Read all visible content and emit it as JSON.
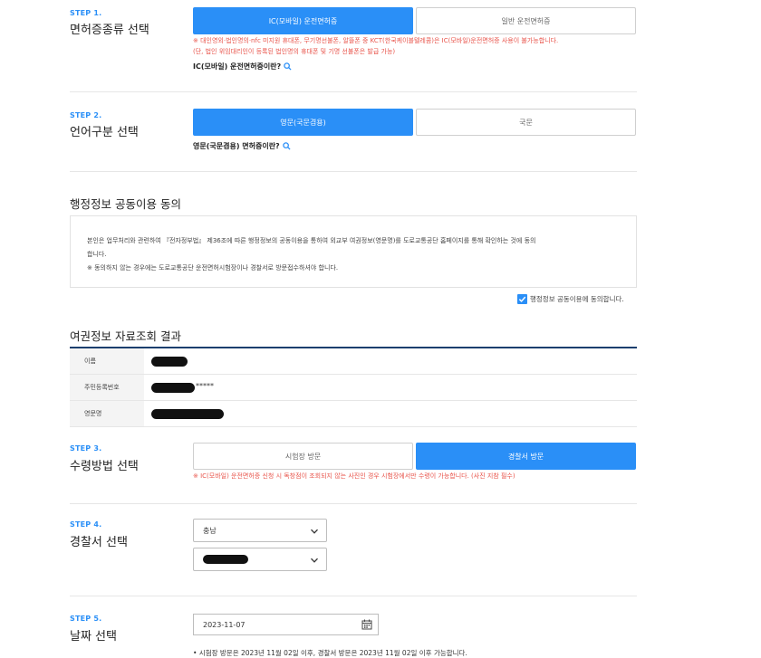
{
  "step1": {
    "label": "STEP 1.",
    "title": "면허증종류 선택",
    "option_ic": "IC(모바일) 운전면허증",
    "option_normal": "일반 운전면허증",
    "note_line1": "※ 대인영외·법인명의·nfc 미지원 휴대폰, 무기명선불폰, 알뜰폰 중 KCT(한국케이블텔레콤)은 IC(모바일)운전면허증 사용이 불가능합니다.",
    "note_line2": "(단, 법인 위임대리인이 등록된 법인명의 휴대폰 및 기명 선불폰은 발급 가능)",
    "info_link": "IC(모바일) 운전면허증이란?"
  },
  "step2": {
    "label": "STEP 2.",
    "title": "언어구분 선택",
    "option_english": "영문(국문겸용)",
    "option_korean": "국문",
    "info_link": "영문(국문겸용) 면허증이란?"
  },
  "consent": {
    "heading": "행정정보 공동이용 동의",
    "text_line1": "본인은 업무처리와 관련하여 『전자정부법』 제36조에 따른 행정정보의 공동이용을 통하여 외교부 여권정보(영문명)를 도로교통공단 홈페이지를 통해 확인하는 것에 동의",
    "text_line2": "합니다.",
    "text_line3": "※ 동의하지 않는 경우에는 도로교통공단 운전면허시험장이나 경찰서로 방문접수하셔야 합니다.",
    "checkbox_label": "행정정보 공동이용에 동의합니다."
  },
  "passport": {
    "heading": "여권정보 자료조회 결과",
    "rows": [
      {
        "label": "이름",
        "value": ""
      },
      {
        "label": "주민등록번호",
        "value": "*****"
      },
      {
        "label": "영문명",
        "value": ""
      }
    ]
  },
  "step3": {
    "label": "STEP 3.",
    "title": "수령방법 선택",
    "option_exam": "시험장 방문",
    "option_police": "경찰서 방문",
    "note": "※ IC(모바일) 운전면허증 신청 시 독창점이 조회되지 않는 사진인 경우 시험장에서만 수령이 가능합니다. (사진 지참 필수)"
  },
  "step4": {
    "label": "STEP 4.",
    "title": "경찰서 선택",
    "region": "충남",
    "station": ""
  },
  "step5": {
    "label": "STEP 5.",
    "title": "날짜 선택",
    "date": "2023-11-07",
    "bullet": "• 시험장 방문은 2023년 11월 02일 이후, 경찰서 방문은 2023년 11월 02일 이후 가능합니다."
  },
  "colors": {
    "accent": "#2a8ff7",
    "warning": "#e8534a",
    "table_border": "#1c3f6e"
  }
}
